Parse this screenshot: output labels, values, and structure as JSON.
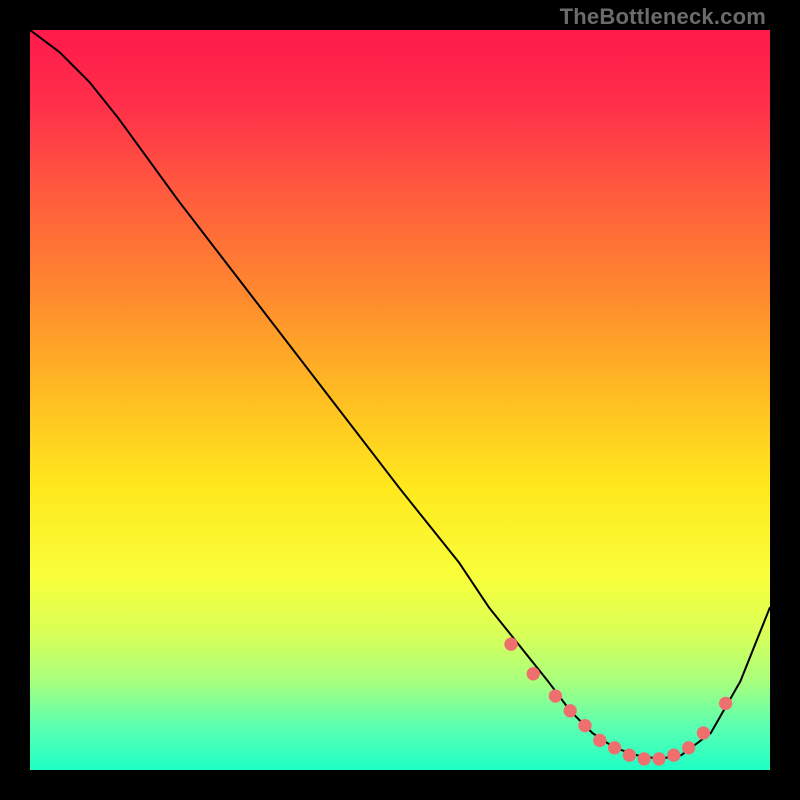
{
  "watermark": "TheBottleneck.com",
  "chart_data": {
    "type": "line",
    "title": "",
    "xlabel": "",
    "ylabel": "",
    "xlim": [
      0,
      100
    ],
    "ylim": [
      0,
      100
    ],
    "curve": {
      "x": [
        0,
        4,
        6,
        8,
        12,
        20,
        30,
        40,
        50,
        58,
        62,
        66,
        70,
        73,
        76,
        79,
        82,
        85,
        88,
        92,
        96,
        100
      ],
      "y": [
        100,
        97,
        95,
        93,
        88,
        77,
        64,
        51,
        38,
        28,
        22,
        17,
        12,
        8,
        5,
        3,
        2,
        1.5,
        2,
        5,
        12,
        22
      ]
    },
    "markers": {
      "x": [
        65,
        68,
        71,
        73,
        75,
        77,
        79,
        81,
        83,
        85,
        87,
        89,
        91,
        94
      ],
      "y": [
        17,
        13,
        10,
        8,
        6,
        4,
        3,
        2,
        1.5,
        1.5,
        2,
        3,
        5,
        9
      ]
    },
    "background_gradient": {
      "stops": [
        {
          "offset": 0.0,
          "color": "#ff1a4b"
        },
        {
          "offset": 0.1,
          "color": "#ff2f4a"
        },
        {
          "offset": 0.22,
          "color": "#ff5b3e"
        },
        {
          "offset": 0.36,
          "color": "#ff8a2e"
        },
        {
          "offset": 0.5,
          "color": "#ffbf22"
        },
        {
          "offset": 0.62,
          "color": "#ffe91e"
        },
        {
          "offset": 0.74,
          "color": "#f8ff3a"
        },
        {
          "offset": 0.82,
          "color": "#d6ff5a"
        },
        {
          "offset": 0.88,
          "color": "#a8ff7d"
        },
        {
          "offset": 0.94,
          "color": "#5dffb0"
        },
        {
          "offset": 1.0,
          "color": "#1fffc6"
        }
      ]
    },
    "marker_color": "#ef6f6f",
    "line_color": "#000000"
  }
}
